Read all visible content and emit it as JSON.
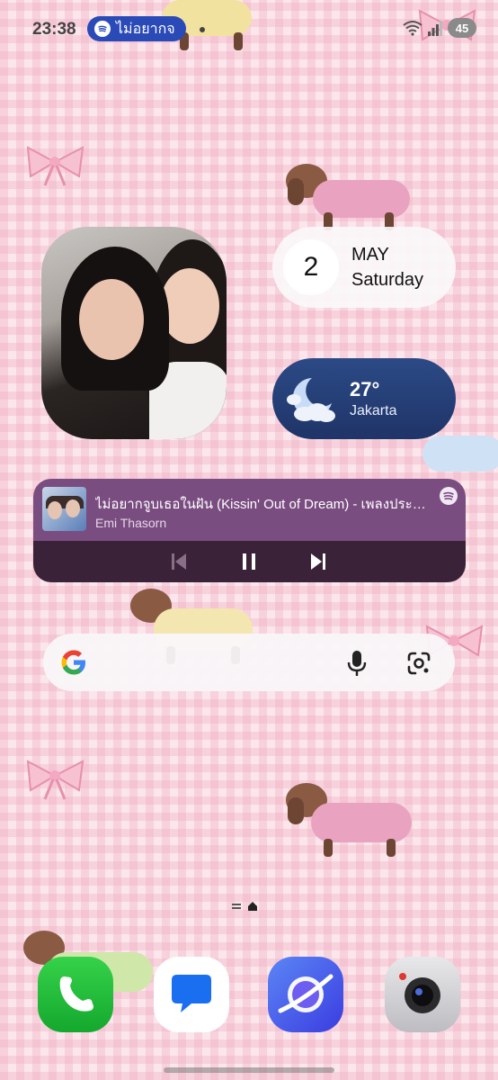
{
  "status_bar": {
    "time": "23:38",
    "media_pill_text": "ไม่อยากจ",
    "battery": "45"
  },
  "date_widget": {
    "day": "2",
    "month": "MAY",
    "weekday": "Saturday"
  },
  "weather_widget": {
    "temperature": "27°",
    "city": "Jakarta",
    "icon": "moon-cloud-icon"
  },
  "music_widget": {
    "title": "ไม่อยากจูบเธอในฝัน (Kissin' Out of Dream) - เพลงประกอบ",
    "artist": "Emi Thasorn",
    "controls": [
      "previous-icon",
      "pause-icon",
      "next-icon"
    ]
  },
  "search_bar": {
    "icons": [
      "google-logo-icon",
      "mic-icon",
      "lens-icon"
    ]
  },
  "dock": {
    "apps": [
      "Phone",
      "Messages",
      "Internet",
      "Camera"
    ]
  },
  "colors": {
    "wallpaper": "#fbe6ec",
    "pill": "#2a4ab8",
    "music_top": "#7a4d81",
    "music_bottom": "#3a2238",
    "weather": "#2c4a86"
  }
}
